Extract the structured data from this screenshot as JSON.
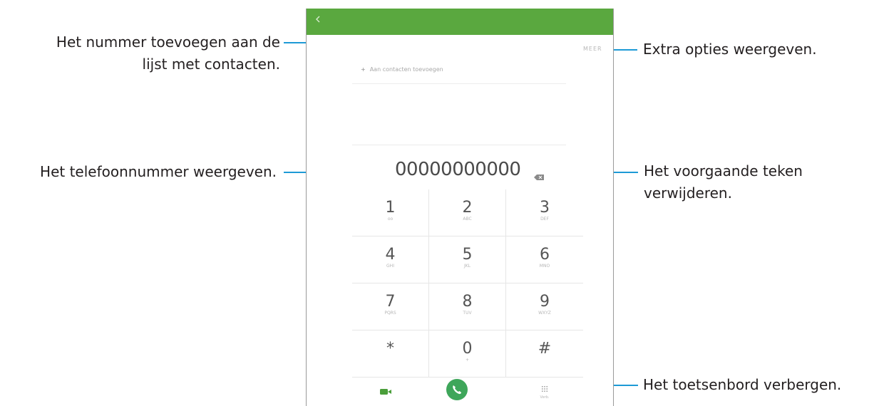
{
  "callouts": {
    "add_contact": {
      "line1": "Het nummer toevoegen aan de",
      "line2": "lijst met contacten."
    },
    "more_options": {
      "line1": "Extra opties weergeven."
    },
    "show_number": {
      "line1": "Het telefoonnummer weergeven."
    },
    "delete_char": {
      "line1": "Het voorgaande teken",
      "line2": "verwijderen."
    },
    "hide_keypad": {
      "line1": "Het toetsenbord verbergen."
    }
  },
  "screen": {
    "more_label": "MEER",
    "add_contact_label": "Aan contacten toevoegen",
    "number": "00000000000",
    "keys": [
      {
        "digit": "1",
        "letters": "oo"
      },
      {
        "digit": "2",
        "letters": "ABC"
      },
      {
        "digit": "3",
        "letters": "DEF"
      },
      {
        "digit": "4",
        "letters": "GHI"
      },
      {
        "digit": "5",
        "letters": "JKL"
      },
      {
        "digit": "6",
        "letters": "MNO"
      },
      {
        "digit": "7",
        "letters": "PQRS"
      },
      {
        "digit": "8",
        "letters": "TUV"
      },
      {
        "digit": "9",
        "letters": "WXYZ"
      },
      {
        "digit": "*",
        "letters": ""
      },
      {
        "digit": "0",
        "letters": "+"
      },
      {
        "digit": "#",
        "letters": ""
      }
    ],
    "hide_keypad_label": "Verb."
  },
  "colors": {
    "accent_line": "#1d9ad6",
    "appbar": "#5aa83f",
    "call_button": "#3ea65a"
  }
}
